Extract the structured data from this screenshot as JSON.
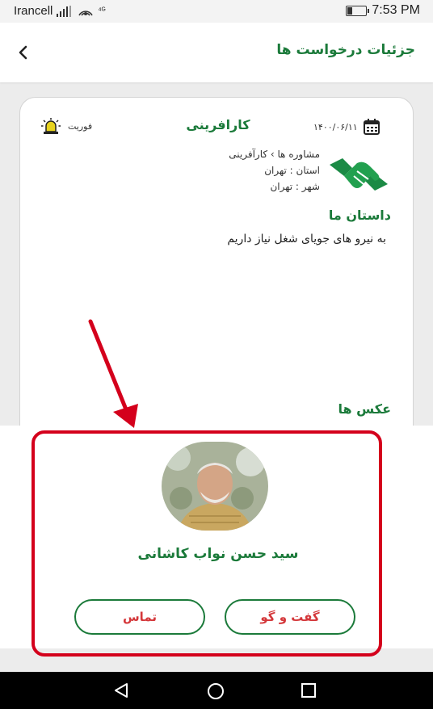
{
  "status_bar": {
    "carrier": "Irancell",
    "signal_text": "⁴ᴳ",
    "time": "7:53 PM",
    "battery_level": 0.3
  },
  "header": {
    "title": "جزئیات درخواست ها"
  },
  "request": {
    "date": "۱۴۰۰/۰۶/۱۱",
    "category_title": "کارافرینی",
    "urgent_label": "فوریت",
    "breadcrumb": "مشاوره ها  ›  کارآفرینی",
    "province": "استان : تهران",
    "city": "شهر : تهران",
    "story_heading": "داستان ما",
    "story_text": "به نیرو های جویای شغل نیاز داریم",
    "photos_heading": "عکس ها"
  },
  "profile": {
    "name": "سید حسن نواب کاشانی",
    "chat_label": "گفت و گو",
    "call_label": "تماس"
  },
  "colors": {
    "accent": "#1b7a3a",
    "highlight": "#d4001c",
    "button_text": "#d4373a"
  }
}
